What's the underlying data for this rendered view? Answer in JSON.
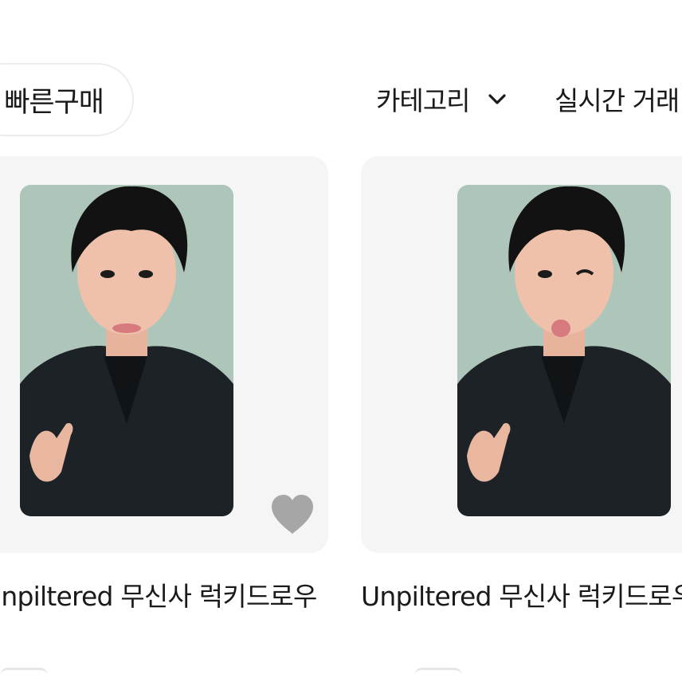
{
  "filters": {
    "quick_buy_label": "빠른구매",
    "category_label": "카테고리",
    "category_icon": "chevron-down-icon",
    "live_trade_label": "실시간 거래"
  },
  "products": [
    {
      "title": "Unpiltered 무신사 럭키드로우",
      "wishlist_icon": "heart-icon",
      "wishlist_color": "#a6a6a6"
    },
    {
      "title": "Unpiltered 무신사 럭키드로우"
    }
  ],
  "colors": {
    "card_bg": "#f5f5f6",
    "pill_border": "#ececec",
    "text": "#1a1a1a"
  }
}
